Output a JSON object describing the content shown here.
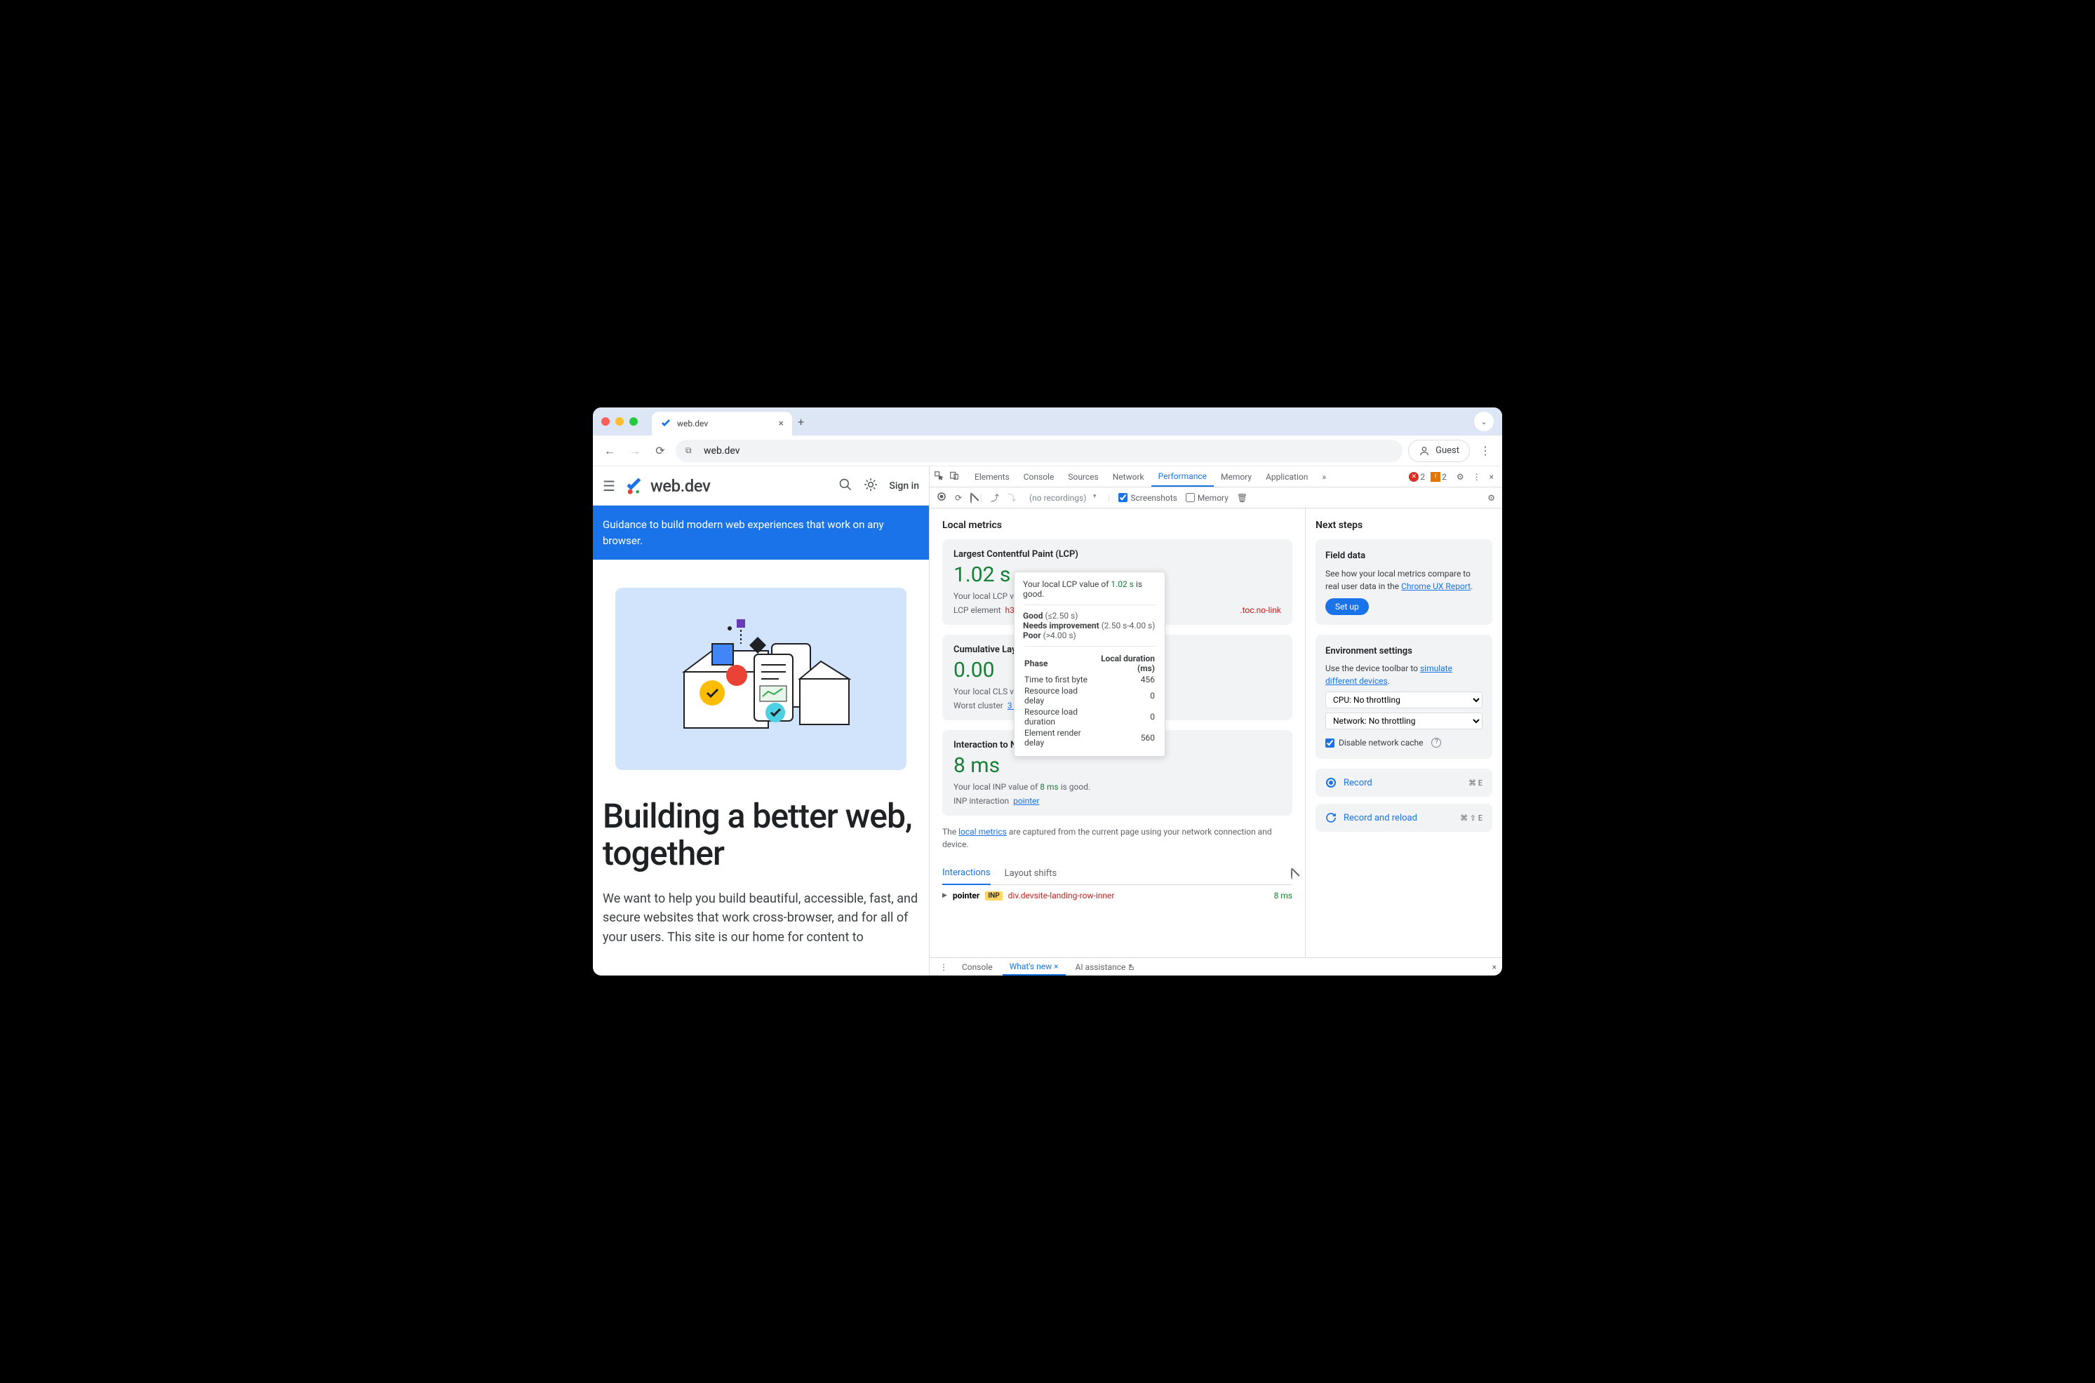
{
  "browser": {
    "tab_title": "web.dev",
    "url": "web.dev",
    "guest": "Guest"
  },
  "page": {
    "logo_text": "web.dev",
    "sign_in": "Sign in",
    "banner": "Guidance to build modern web experiences that work on any browser.",
    "hero_title": "Building a better web, together",
    "hero_text": "We want to help you build beautiful, accessible, fast, and secure websites that work cross-browser, and for all of your users. This site is our home for content to"
  },
  "devtools": {
    "tabs": [
      "Elements",
      "Console",
      "Sources",
      "Network",
      "Performance",
      "Memory",
      "Application"
    ],
    "active_tab": "Performance",
    "errors": "2",
    "warnings": "2",
    "subtoolbar": {
      "no_recordings": "(no recordings)",
      "screenshots": "Screenshots",
      "memory": "Memory"
    },
    "metrics_title": "Local metrics",
    "lcp": {
      "title": "Largest Contentful Paint (LCP)",
      "value": "1.02 s",
      "sub_prefix": "Your local LCP valu",
      "elem_label": "LCP element",
      "elem_tag": "h3#b",
      "elem_trail": ".toc.no-link"
    },
    "cls": {
      "title": "Cumulative Layo",
      "value": "0.00",
      "sub_prefix": "Your local CLS valu",
      "cluster_label": "Worst cluster",
      "cluster_link": "3 shifts"
    },
    "inp": {
      "title": "Interaction to Next Paint (INP)",
      "value": "8 ms",
      "sub_prefix": "Your local INP value of ",
      "sub_value": "8 ms",
      "sub_suffix": " is good.",
      "int_label": "INP interaction",
      "int_link": "pointer"
    },
    "note_prefix": "The ",
    "note_link": "local metrics",
    "note_suffix": " are captured from the current page using your network connection and device.",
    "tabs_interactions": "Interactions",
    "tabs_layout": "Layout shifts",
    "interaction": {
      "kind": "pointer",
      "chip": "INP",
      "selector": "div.devsite-landing-row-inner",
      "time": "8 ms"
    },
    "tooltip": {
      "line1_prefix": "Your local LCP value of ",
      "line1_value": "1.02 s",
      "line1_suffix": " is good.",
      "good_label": "Good",
      "good_range": "(≤2.50 s)",
      "ni_label": "Needs improvement",
      "ni_range": "(2.50 s-4.00 s)",
      "poor_label": "Poor",
      "poor_range": "(>4.00 s)",
      "phase": "Phase",
      "duration": "Local duration (ms)",
      "rows": [
        {
          "label": "Time to first byte",
          "val": "456"
        },
        {
          "label": "Resource load delay",
          "val": "0"
        },
        {
          "label": "Resource load duration",
          "val": "0"
        },
        {
          "label": "Element render delay",
          "val": "560"
        }
      ]
    },
    "nextsteps_title": "Next steps",
    "field": {
      "title": "Field data",
      "text_prefix": "See how your local metrics compare to real user data in the ",
      "link": "Chrome UX Report",
      "btn": "Set up"
    },
    "env": {
      "title": "Environment settings",
      "text_prefix": "Use the device toolbar to ",
      "link": "simulate different devices",
      "cpu": "CPU: No throttling",
      "network": "Network: No throttling",
      "disable_cache": "Disable network cache"
    },
    "record": {
      "label": "Record",
      "kbd": "⌘ E"
    },
    "record_reload": {
      "label": "Record and reload",
      "kbd": "⌘ ⇧ E"
    },
    "drawer": {
      "console": "Console",
      "whatsnew": "What's new",
      "ai": "AI assistance"
    }
  }
}
